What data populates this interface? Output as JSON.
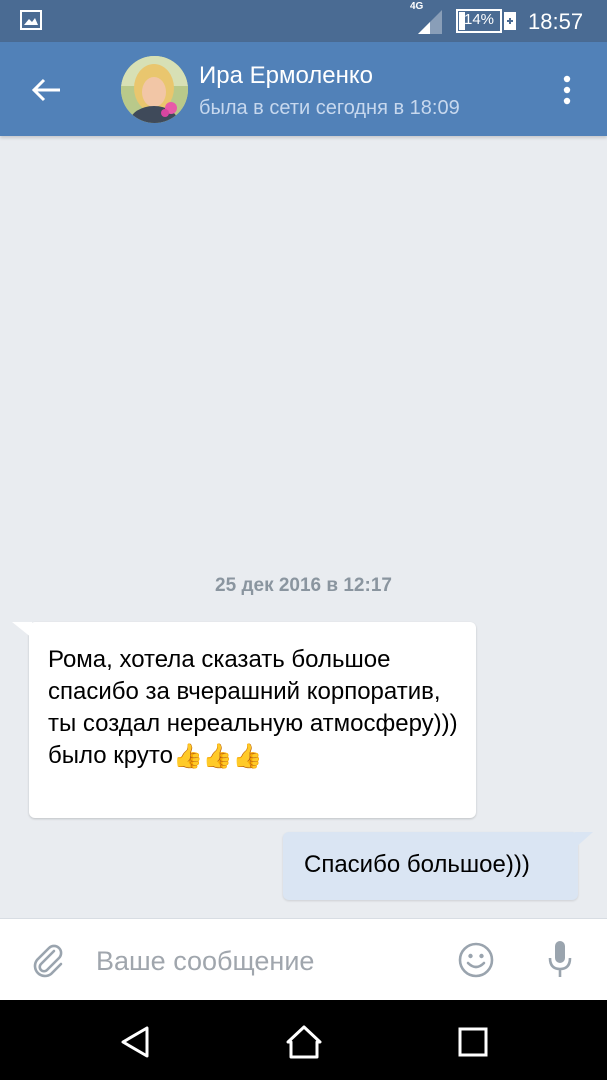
{
  "status_bar": {
    "network": "4G",
    "battery": "14%",
    "time": "18:57"
  },
  "header": {
    "contact_name": "Ира Ермоленко",
    "contact_status": "была в сети сегодня в 18:09"
  },
  "messages": {
    "date_separator": "25 дек 2016 в 12:17",
    "incoming": {
      "text": "Рома, хотела сказать большое спасибо за вчерашний корпоратив, ты создал нереальную атмосферу))) было круто",
      "emoji": "👍👍👍"
    },
    "outgoing": {
      "text": "Спасибо большое)))"
    }
  },
  "composer": {
    "placeholder": "Ваше сообщение",
    "value": ""
  },
  "colors": {
    "status_bar": "#4a6b93",
    "toolbar": "#5181b8",
    "chat_background": "#e9ecf0",
    "incoming_bubble": "#ffffff",
    "outgoing_bubble": "#dae5f3"
  },
  "icons": {
    "status_left": "gallery-icon",
    "signal": "signal-icon",
    "battery": "battery-charging-icon",
    "back": "arrow-left-icon",
    "menu": "more-vertical-icon",
    "attach": "paperclip-icon",
    "emoji": "smiley-icon",
    "mic": "microphone-icon",
    "nav_back": "triangle-back-icon",
    "nav_home": "home-icon",
    "nav_recent": "square-recent-icon"
  }
}
